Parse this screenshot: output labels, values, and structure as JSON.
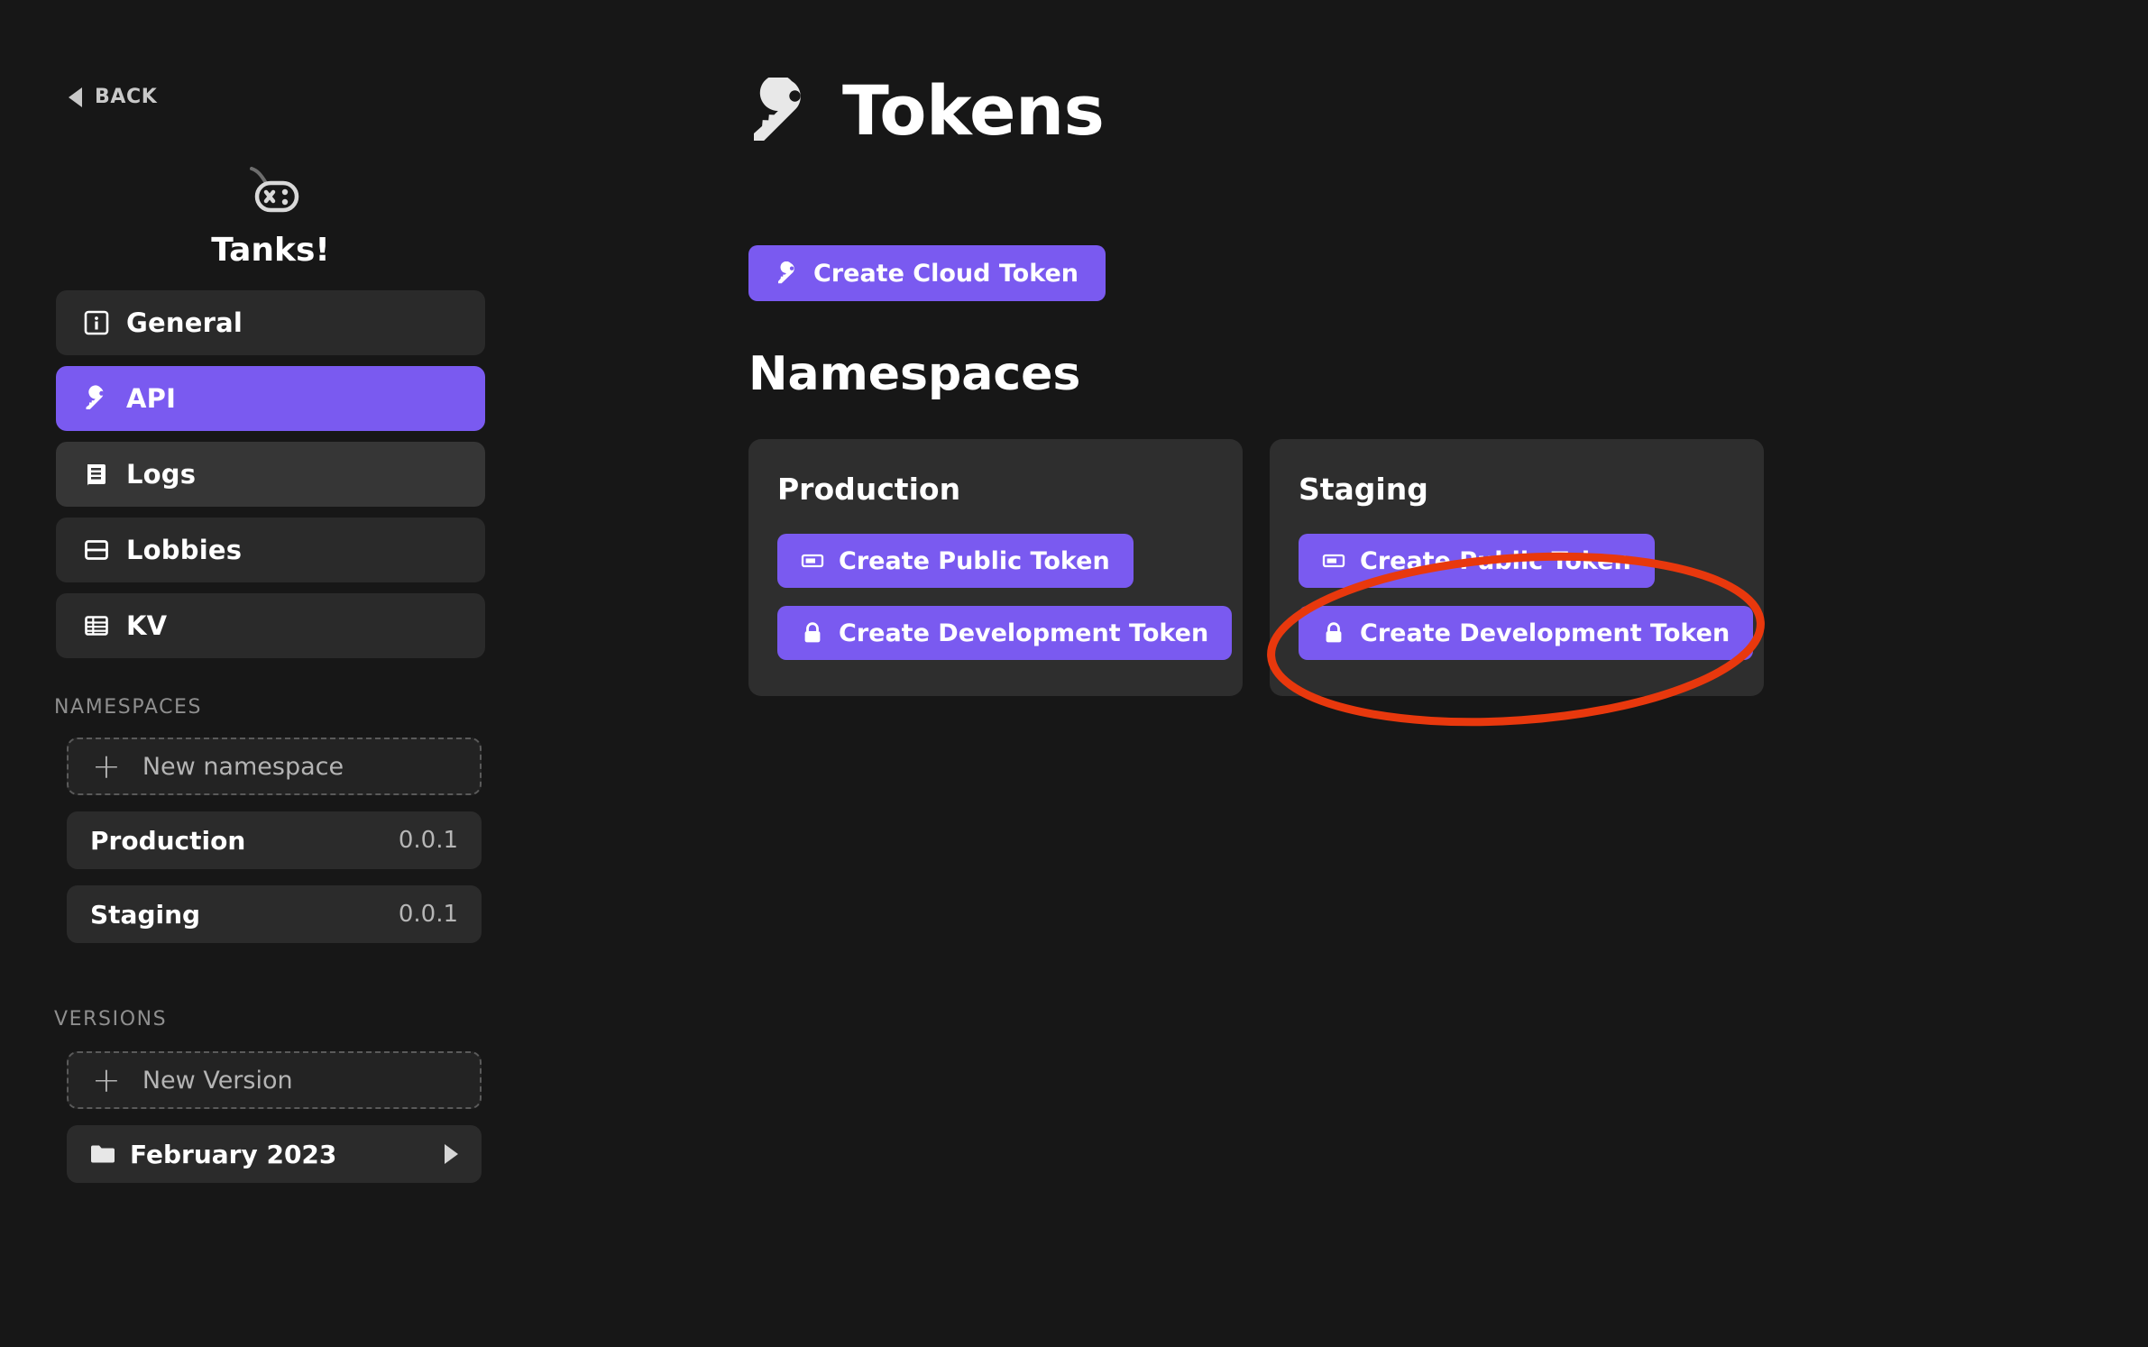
{
  "sidebar": {
    "back_label": "BACK",
    "back_icon": "triangle-left-icon",
    "game": {
      "name": "Tanks!",
      "icon": "gamepad-icon"
    },
    "nav": [
      {
        "label": "General",
        "icon": "info-square-icon",
        "state": "default"
      },
      {
        "label": "API",
        "icon": "key-icon",
        "state": "active"
      },
      {
        "label": "Logs",
        "icon": "book-icon",
        "state": "hovered"
      },
      {
        "label": "Lobbies",
        "icon": "window-split-icon",
        "state": "default"
      },
      {
        "label": "KV",
        "icon": "table-icon",
        "state": "default"
      }
    ],
    "namespaces": {
      "heading": "NAMESPACES",
      "new_label": "New namespace",
      "new_icon": "plus-icon",
      "items": [
        {
          "name": "Production",
          "version": "0.0.1"
        },
        {
          "name": "Staging",
          "version": "0.0.1"
        }
      ]
    },
    "versions": {
      "heading": "VERSIONS",
      "new_label": "New Version",
      "new_icon": "plus-icon",
      "items": [
        {
          "name": "February 2023",
          "icon": "folder-icon",
          "chevron": "triangle-right-icon"
        }
      ]
    }
  },
  "main": {
    "title": "Tokens",
    "title_icon": "key-icon",
    "cloud_token_button": {
      "label": "Create Cloud Token",
      "icon": "key-icon"
    },
    "section_title": "Namespaces",
    "cards": [
      {
        "title": "Production",
        "buttons": [
          {
            "label": "Create Public Token",
            "icon": "ticket-icon"
          },
          {
            "label": "Create Development Token",
            "icon": "lock-icon"
          }
        ]
      },
      {
        "title": "Staging",
        "buttons": [
          {
            "label": "Create Public Token",
            "icon": "ticket-icon"
          },
          {
            "label": "Create Development Token",
            "icon": "lock-icon"
          }
        ]
      }
    ]
  },
  "annotation": {
    "shape": "ellipse-highlight",
    "color": "#e8380d",
    "target": "staging-create-development-token-button"
  },
  "colors": {
    "background": "#171717",
    "accent_purple": "#7a5af0",
    "card": "#2e2e2e",
    "nav_item": "#2a2a2a",
    "nav_item_hover": "#363636",
    "annotation_red": "#e8380d",
    "text_primary": "#ffffff",
    "text_muted": "#8f8f8f"
  }
}
